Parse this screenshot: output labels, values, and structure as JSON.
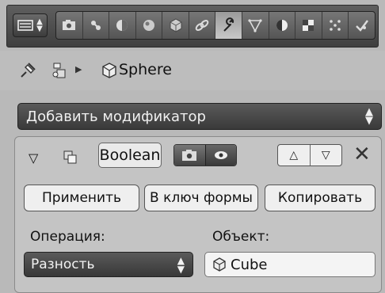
{
  "toolbar": {
    "editor_type_icon": "properties-editor-icon",
    "tabs": [
      {
        "icon": "render-camera-icon",
        "glyph": "▣"
      },
      {
        "icon": "render-layers-icon",
        "glyph": "✦"
      },
      {
        "icon": "scene-icon",
        "glyph": "◐"
      },
      {
        "icon": "world-icon",
        "glyph": "◕"
      },
      {
        "icon": "object-constraint-icon",
        "glyph": "⚯"
      },
      {
        "icon": "modifier-wrench-icon",
        "glyph": "🔧",
        "active": true
      },
      {
        "icon": "data-mesh-icon",
        "glyph": "▽"
      },
      {
        "icon": "material-icon",
        "glyph": "◑"
      },
      {
        "icon": "texture-icon",
        "glyph": "▩"
      },
      {
        "icon": "particles-icon",
        "glyph": "⁘"
      },
      {
        "icon": "physics-icon",
        "glyph": "✓"
      }
    ]
  },
  "breadcrumb": {
    "object_name": "Sphere"
  },
  "add_modifier": {
    "label": "Добавить модификатор"
  },
  "modifier": {
    "name": "Boolean",
    "apply_label": "Применить",
    "to_shape_label": "В ключ формы",
    "copy_label": "Копировать",
    "operation_label": "Операция:",
    "operation_value": "Разность",
    "object_label": "Объект:",
    "object_value": "Cube"
  }
}
